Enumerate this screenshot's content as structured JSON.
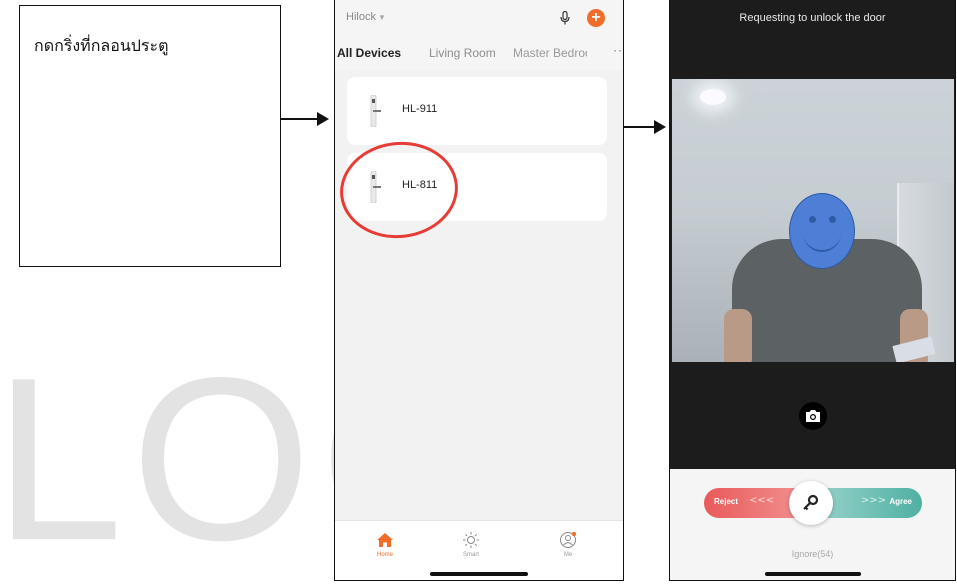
{
  "watermark": {
    "text": "LOC"
  },
  "note": {
    "text": "กดกริ่งที่กลอนประตู"
  },
  "app": {
    "brand": "Hilock",
    "tabs": [
      "All Devices",
      "Living Room",
      "Master Bedroo"
    ],
    "devices": [
      {
        "name": "HL-911"
      },
      {
        "name": "HL-811"
      }
    ],
    "bottom_nav": [
      "Home",
      "Smart",
      "Me"
    ],
    "accent_color": "#f26c2a",
    "highlight_color": "#e53c35"
  },
  "door_request": {
    "title": "Requesting to unlock the door",
    "reject_label": "Reject",
    "reject_chevrons": "<<<",
    "agree_chevrons": ">>>",
    "agree_label": "Agree",
    "ignore_label": "Ignore(54)",
    "reject_color": "#ea5a5a",
    "agree_color": "#4fb0a3"
  }
}
